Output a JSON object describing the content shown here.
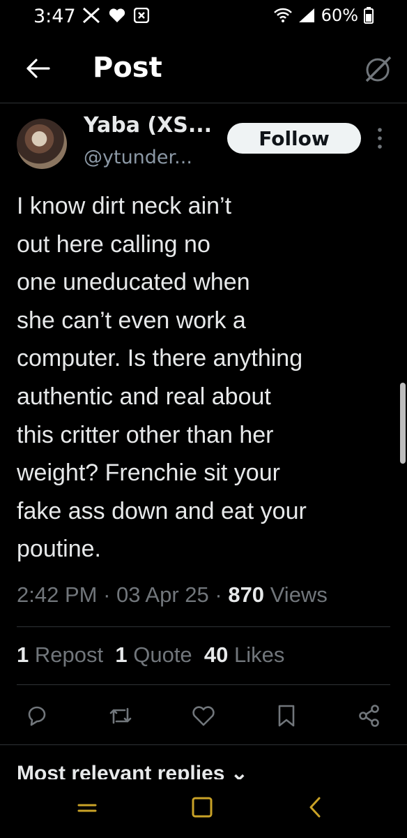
{
  "status_bar": {
    "time": "3:47",
    "battery": "60%",
    "icons": [
      "x-logo-icon",
      "heart-icon",
      "notification-box-icon",
      "wifi-icon",
      "signal-icon",
      "battery-icon"
    ]
  },
  "header": {
    "title": "Post",
    "back_icon": "arrow-left-icon",
    "grok_icon": "grok-icon"
  },
  "post": {
    "author_name": "Yaba (XS...",
    "author_handle": "@ytunder...",
    "follow_label": "Follow",
    "text": "I know dirt neck ain’t\nout here calling no\none uneducated when\nshe can’t even work a\ncomputer. Is there anything\nauthentic and real about\nthis critter other than her\nweight? Frenchie sit your\nfake ass down and eat your\npoutine.",
    "time": "2:42 PM",
    "date": "03 Apr 25",
    "views_count": "870",
    "views_label": "Views",
    "separator": "·"
  },
  "stats": {
    "reposts_count": "1",
    "reposts_label": "Repost",
    "quotes_count": "1",
    "quotes_label": "Quote",
    "likes_count": "40",
    "likes_label": "Likes"
  },
  "actions": [
    "reply-icon",
    "repost-icon",
    "like-icon",
    "bookmark-icon",
    "share-icon"
  ],
  "replies": {
    "sort_label": "Most relevant replies",
    "chevron": "⌄"
  },
  "colors": {
    "background": "#000000",
    "text_primary": "#e7e9ea",
    "text_secondary": "#71767b",
    "divider": "#2f3336",
    "follow_bg": "#eff3f4",
    "nav_accent": "#c9a227"
  }
}
